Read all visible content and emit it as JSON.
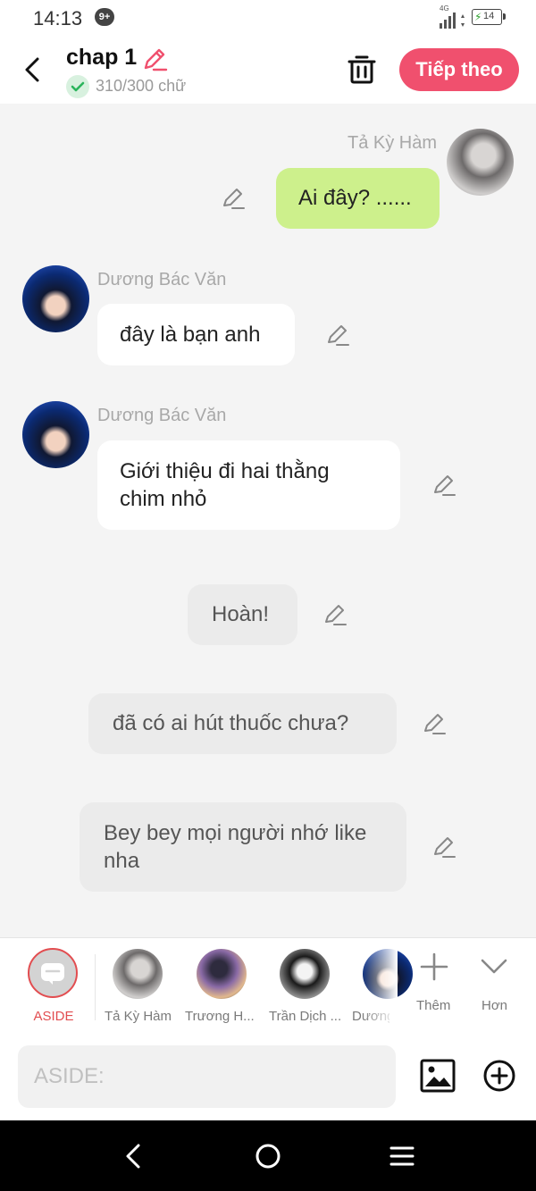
{
  "status_bar": {
    "time": "14:13",
    "notification_badge": "9+",
    "network": "4G",
    "battery": "14"
  },
  "header": {
    "title": "chap 1",
    "word_count": "310/300 chữ",
    "next_label": "Tiếp theo",
    "accent_color": "#f0506e"
  },
  "messages": [
    {
      "sender": "Tả Kỳ Hàm",
      "text": "Ai đây? ......",
      "side": "right",
      "style": "green"
    },
    {
      "sender": "Dương Bác Văn",
      "text": "đây là bạn anh",
      "side": "left",
      "style": "white"
    },
    {
      "sender": "Dương Bác Văn",
      "text": "Giới thiệu đi hai thằng chim nhỏ",
      "side": "left",
      "style": "white"
    },
    {
      "sender": "",
      "text": "Hoàn!",
      "side": "center",
      "style": "gray"
    },
    {
      "sender": "",
      "text": "đã có ai hút thuốc chưa?",
      "side": "center",
      "style": "gray"
    },
    {
      "sender": "",
      "text": "Bey bey mọi người nhớ like nha",
      "side": "center",
      "style": "gray"
    }
  ],
  "character_bar": {
    "aside_label": "ASIDE",
    "characters": [
      {
        "name": "Tả Kỳ Hàm",
        "icon": "avatar-ta-ky-ham"
      },
      {
        "name": "Trương H...",
        "icon": "avatar-truong"
      },
      {
        "name": "Trần Dịch ...",
        "icon": "avatar-tran-dich"
      },
      {
        "name": "Dương",
        "icon": "avatar-duong"
      }
    ],
    "add_label": "Thêm",
    "more_label": "Hơn"
  },
  "composer": {
    "placeholder": "ASIDE:",
    "value": ""
  }
}
